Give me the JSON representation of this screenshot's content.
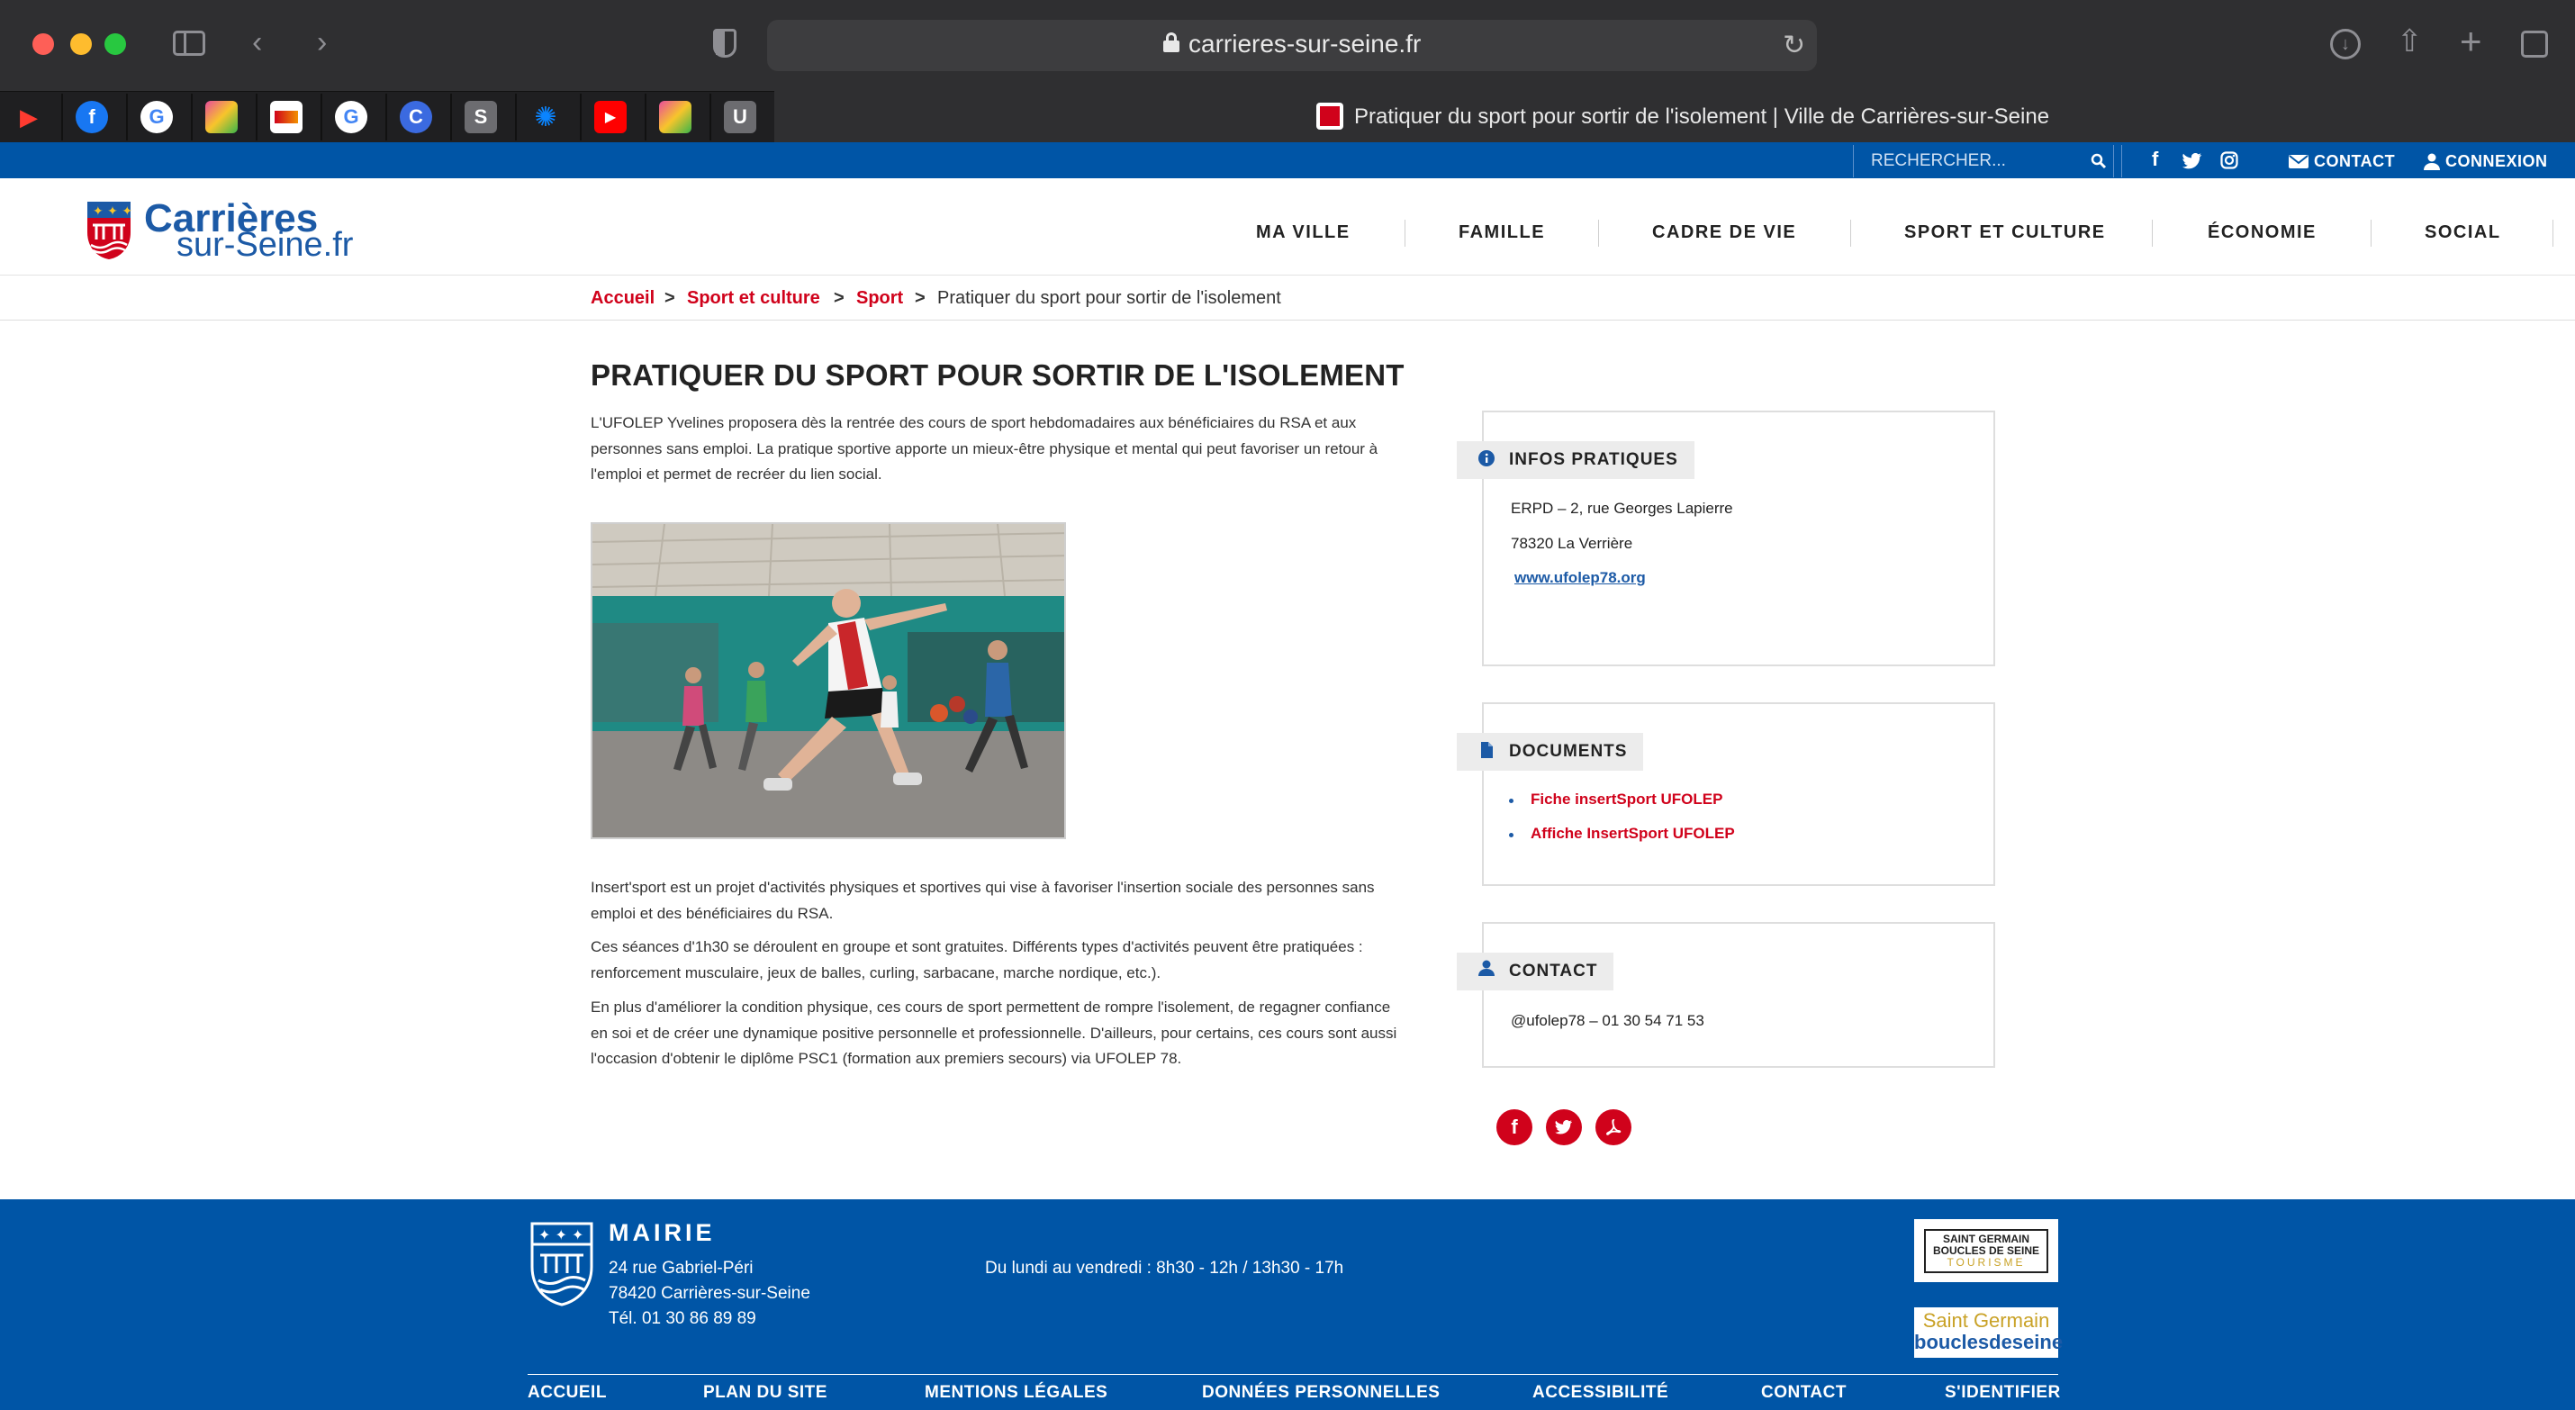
{
  "browser": {
    "url": "carrieres-sur-seine.fr",
    "tab_title": "Pratiquer du sport pour sortir de l'isolement | Ville de Carrières-sur-Seine"
  },
  "topbar": {
    "search_placeholder": "RECHERCHER...",
    "contact": "CONTACT",
    "connexion": "CONNEXION"
  },
  "logo": {
    "line1": "Carrières",
    "line2": "sur-Seine.fr"
  },
  "nav": [
    "MA VILLE",
    "FAMILLE",
    "CADRE DE VIE",
    "SPORT ET CULTURE",
    "ÉCONOMIE",
    "SOCIAL"
  ],
  "breadcrumb": {
    "items": [
      "Accueil",
      "Sport et culture",
      "Sport"
    ],
    "current": "Pratiquer du sport pour sortir de l'isolement",
    "separator": ">"
  },
  "article": {
    "title": "PRATIQUER DU SPORT POUR SORTIR DE L'ISOLEMENT",
    "intro": "L'UFOLEP Yvelines proposera dès la rentrée des cours de sport hebdomadaires aux bénéficiaires du RSA et aux personnes sans emploi.  La pratique sportive apporte un mieux-être physique et mental qui peut favoriser un retour à l'emploi et permet de recréer du lien social.",
    "p1": "Insert'sport est un projet d'activités physiques et sportives qui vise à favoriser l'insertion sociale des personnes sans emploi et des bénéficiaires du RSA.",
    "p2": "Ces séances d'1h30 se déroulent en groupe et sont gratuites. Différents types d'activités peuvent être pratiquées : renforcement musculaire, jeux de balles, curling, sarbacane, marche nordique, etc.).",
    "p3": "En plus d'améliorer la condition physique, ces cours de sport permettent de rompre l'isolement, de regagner confiance en soi et de créer une dynamique positive personnelle et professionnelle. D'ailleurs, pour certains, ces cours sont aussi l'occasion d'obtenir le diplôme PSC1 (formation aux premiers secours) via UFOLEP 78."
  },
  "infos": {
    "label": "INFOS PRATIQUES",
    "address1": "ERPD – 2, rue Georges Lapierre",
    "address2": "78320 La Verrière",
    "link": "www.ufolep78.org"
  },
  "documents": {
    "label": "DOCUMENTS",
    "items": [
      "Fiche insertSport UFOLEP",
      "Affiche InsertSport UFOLEP"
    ]
  },
  "contact_box": {
    "label": "CONTACT",
    "text": "@ufolep78 – 01 30 54 71 53"
  },
  "footer": {
    "title": "MAIRIE",
    "address1": "24 rue Gabriel-Péri",
    "address2": "78420 Carrières-sur-Seine",
    "phone": "Tél. 01 30 86 89 89",
    "hours": "Du lundi au vendredi : 8h30 - 12h / 13h30 - 17h",
    "badge1_l1": "SAINT GERMAIN",
    "badge1_l2": "BOUCLES DE SEINE",
    "badge1_l3": "TOURISME",
    "badge2_l1": "Saint Germain",
    "badge2_l2": "bouclesdeseine",
    "links": [
      "ACCUEIL",
      "PLAN DU SITE",
      "MENTIONS LÉGALES",
      "DONNÉES PERSONNELLES",
      "ACCESSIBILITÉ",
      "CONTACT",
      "S'IDENTIFIER"
    ]
  },
  "colors": {
    "brand_blue": "#0055a6",
    "accent_red": "#d0021b"
  }
}
